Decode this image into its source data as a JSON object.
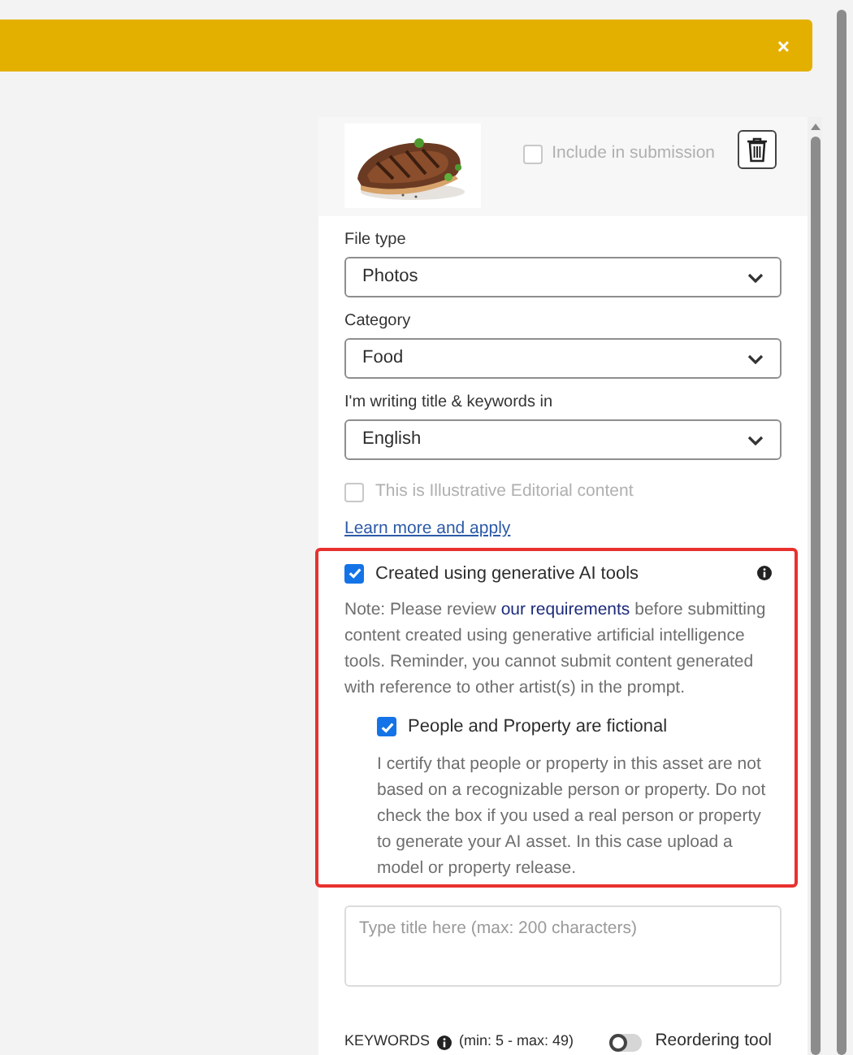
{
  "banner": {
    "close": "×"
  },
  "asset": {
    "include": {
      "label": "Include in submission",
      "checked": false,
      "disabled": true
    }
  },
  "fields": [
    {
      "label": "File type",
      "value": "Photos"
    },
    {
      "label": "Category",
      "value": "Food"
    },
    {
      "label": "I'm writing title & keywords in",
      "value": "English"
    }
  ],
  "editorial": {
    "label": "This is Illustrative Editorial content",
    "checked": false,
    "disabled": true
  },
  "learn_more": "Learn more and apply",
  "ai": {
    "label": "Created using generative AI tools",
    "checked": true,
    "note_before": "Note: Please review",
    "note_link": "our requirements",
    "note_after": "before submitting content created using generative artificial intelligence tools. Reminder, you cannot submit content generated with reference to other artist(s) in the prompt.",
    "fictional": {
      "label": "People and Property are fictional",
      "checked": true,
      "description": "I certify that people or property in this asset are not based on a recognizable person or property. Do not check the box if you used a real person or property to generate your AI asset. In this case upload a model or property release."
    }
  },
  "title_field": {
    "placeholder": "Type title here (max: 200 characters)"
  },
  "keywords": {
    "label": "KEYWORDS",
    "range": "(min: 5 - max: 49)",
    "toggle": {
      "label": "Reordering tool",
      "on": false
    }
  }
}
